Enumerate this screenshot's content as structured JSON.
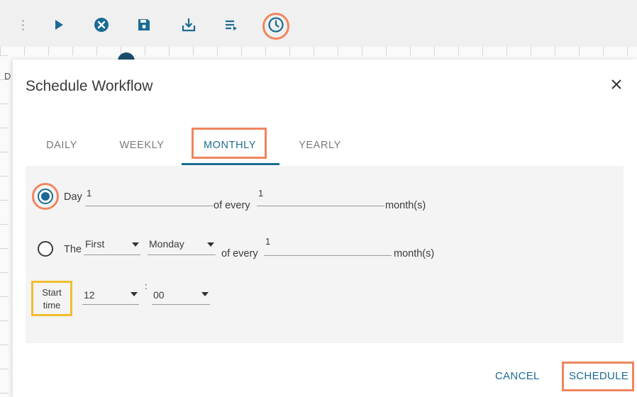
{
  "toolbar": {
    "buttons": [
      {
        "icon": "play-icon"
      },
      {
        "icon": "cancel-circle-icon"
      },
      {
        "icon": "save-icon"
      },
      {
        "icon": "download-icon"
      },
      {
        "icon": "list-icon"
      },
      {
        "icon": "clock-icon"
      }
    ],
    "accent_color": "#1b6b93",
    "highlight_color": "#f0855e"
  },
  "background": {
    "letter": "D"
  },
  "dialog": {
    "title": "Schedule Workflow",
    "close_icon": "close-icon",
    "tabs": [
      {
        "label": "DAILY",
        "active": false
      },
      {
        "label": "WEEKLY",
        "active": false
      },
      {
        "label": "MONTHLY",
        "active": true
      },
      {
        "label": "YEARLY",
        "active": false
      }
    ],
    "option_day": {
      "selected": true,
      "label": "Day",
      "day_value": "1",
      "of_every_label": "of every",
      "month_count": "1",
      "unit_label": "month(s)"
    },
    "option_the": {
      "selected": false,
      "label": "The",
      "ordinal": "First",
      "weekday": "Monday",
      "of_every_label": "of every",
      "month_count": "1",
      "unit_label": "month(s)"
    },
    "start_time": {
      "label_line1": "Start",
      "label_line2": "time",
      "hour": "12",
      "separator": ":",
      "minute": "00"
    },
    "actions": {
      "cancel": "CANCEL",
      "schedule": "SCHEDULE"
    }
  }
}
